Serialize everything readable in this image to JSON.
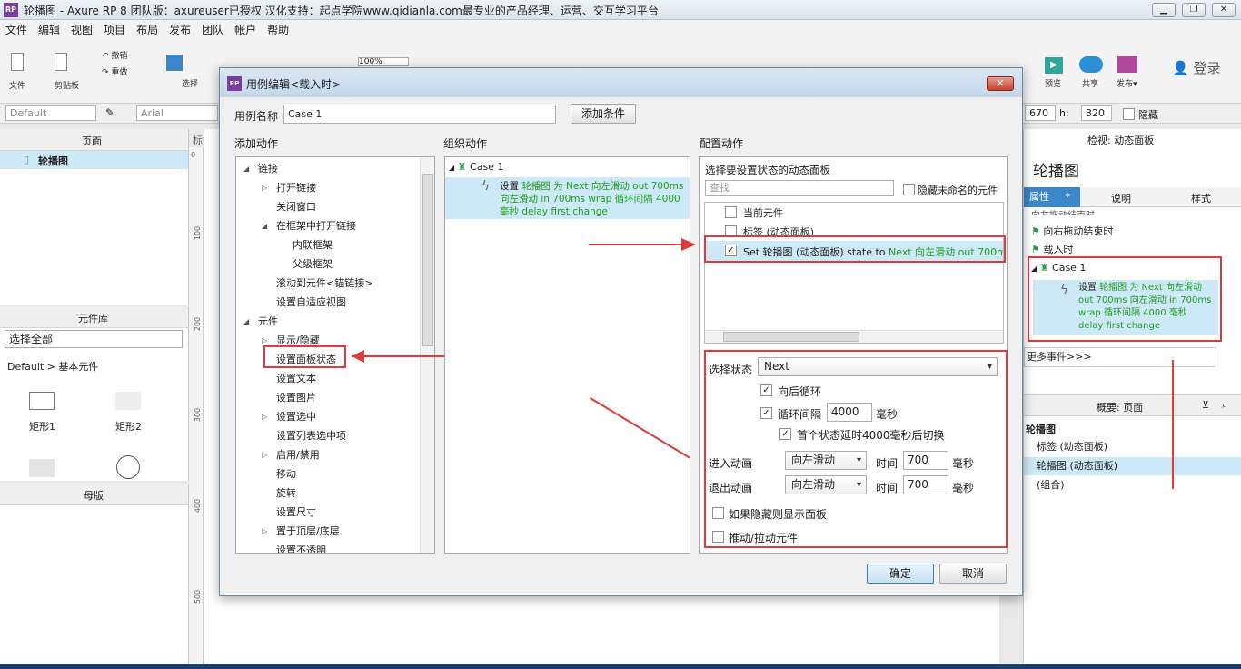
{
  "window": {
    "title": "轮播图 - Axure RP 8 团队版：axureuser已授权 汉化支持：起点学院www.qidianla.com最专业的产品经理、运营、交互学习平台",
    "app_icon": "RP",
    "controls": [
      "▁",
      "❐",
      "✕"
    ]
  },
  "menu": [
    "文件",
    "编辑",
    "视图",
    "项目",
    "布局",
    "发布",
    "团队",
    "帐户",
    "帮助"
  ],
  "toolbar": {
    "file": "文件",
    "clipboard": "剪贴板",
    "undo": "撤销",
    "redo": "重做",
    "select": "选择",
    "zoom": "100%",
    "preview": "预览",
    "share": "共享",
    "publish": "发布▾",
    "login": "登录"
  },
  "stylebar": {
    "style": "Default",
    "font": "Arial",
    "w_value": "670",
    "h_label": "h:",
    "h_value": "320",
    "hidden": "隐藏"
  },
  "left": {
    "pages_title": "页面",
    "page_item": "轮播图",
    "canvas_tab": "标签",
    "library_title": "元件库",
    "library_select": "选择全部",
    "library_group": "Default > 基本元件",
    "widgets": [
      "矩形1",
      "矩形2"
    ],
    "masters_title": "母版"
  },
  "ruler": [
    "0",
    "100",
    "200",
    "300",
    "400",
    "500"
  ],
  "right": {
    "inspect_title": "检视: 动态面板",
    "name": "轮播图",
    "tabs": [
      "属性",
      "说明",
      "样式"
    ],
    "tab_star": "*",
    "events": [
      "向左拖动结束时",
      "向右拖动结束时",
      "载入时"
    ],
    "case": "Case 1",
    "case_action_prefix": "设置",
    "case_action_green": "轮播图 为 Next 向左滑动 out 700ms 向左滑动 in 700ms wrap 循环间隔 4000 毫秒 delay first change",
    "more_events": "更多事件>>>",
    "outline_title": "概要: 页面",
    "outline_root": "轮播图",
    "outline_items": [
      "标签 (动态面板)",
      "轮播图 (动态面板)",
      "(组合)"
    ]
  },
  "dialog": {
    "title": "用例编辑<载入时>",
    "case_name_label": "用例名称",
    "case_name_value": "Case 1",
    "add_condition": "添加条件",
    "add_action_title": "添加动作",
    "organize_title": "组织动作",
    "configure_title": "配置动作",
    "actions_tree": [
      {
        "label": "链接",
        "level": 0,
        "expanded": true
      },
      {
        "label": "打开链接",
        "level": 1,
        "collapsed": true
      },
      {
        "label": "关闭窗口",
        "level": 1
      },
      {
        "label": "在框架中打开链接",
        "level": 1,
        "expanded": true
      },
      {
        "label": "内联框架",
        "level": 2
      },
      {
        "label": "父级框架",
        "level": 2
      },
      {
        "label": "滚动到元件<锚链接>",
        "level": 1
      },
      {
        "label": "设置自适应视图",
        "level": 1
      },
      {
        "label": "元件",
        "level": 0,
        "expanded": true
      },
      {
        "label": "显示/隐藏",
        "level": 1,
        "collapsed": true
      },
      {
        "label": "设置面板状态",
        "level": 1
      },
      {
        "label": "设置文本",
        "level": 1
      },
      {
        "label": "设置图片",
        "level": 1
      },
      {
        "label": "设置选中",
        "level": 1,
        "collapsed": true
      },
      {
        "label": "设置列表选中项",
        "level": 1
      },
      {
        "label": "启用/禁用",
        "level": 1,
        "collapsed": true
      },
      {
        "label": "移动",
        "level": 1
      },
      {
        "label": "旋转",
        "level": 1
      },
      {
        "label": "设置尺寸",
        "level": 1
      },
      {
        "label": "置于顶层/底层",
        "level": 1,
        "collapsed": true
      },
      {
        "label": "设置不透明",
        "level": 1
      }
    ],
    "organize": {
      "case": "Case 1",
      "action_prefix": "设置",
      "action_green": "轮播图 为 Next 向左滑动 out 700ms 向左滑动 in 700ms wrap 循环间隔 4000 毫秒 delay first change"
    },
    "configure": {
      "select_panel_label": "选择要设置状态的动态面板",
      "search_placeholder": "查找",
      "hide_unnamed": "隐藏未命名的元件",
      "panel_rows": [
        {
          "label": "当前元件",
          "checked": false
        },
        {
          "label": "标签 (动态面板)",
          "checked": false
        }
      ],
      "selected_row_prefix": "Set 轮播图 (动态面板) state to",
      "selected_row_green": "Next 向左滑动 out 700ms 向",
      "state_label": "选择状态",
      "state_value": "Next",
      "wrap_label": "向后循环",
      "loop_label": "循环间隔",
      "loop_value": "4000",
      "ms": "毫秒",
      "first_delay": "首个状态延时4000毫秒后切换",
      "enter_anim_label": "进入动画",
      "enter_anim_value": "向左滑动",
      "exit_anim_label": "退出动画",
      "exit_anim_value": "向左滑动",
      "time_label": "时间",
      "enter_time": "700",
      "exit_time": "700",
      "show_if_hidden": "如果隐藏则显示面板",
      "push_pull": "推动/拉动元件"
    },
    "ok": "确定",
    "cancel": "取消"
  },
  "colors": {
    "accent_blue": "#3c87c9",
    "highlight": "#cde8f7",
    "annotation_red": "#e03a3a",
    "action_green": "#20a020"
  }
}
